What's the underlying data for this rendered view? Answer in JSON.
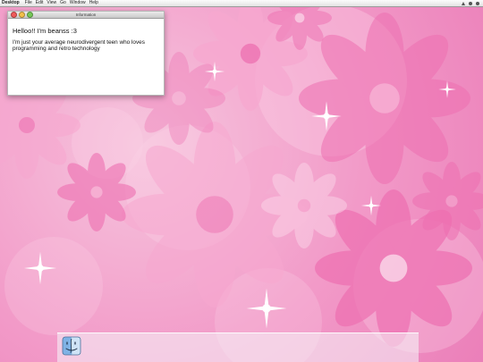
{
  "menubar": {
    "app_name": "Desktop",
    "items": [
      "File",
      "Edit",
      "View",
      "Go",
      "Window",
      "Help"
    ],
    "status_icons": [
      "wifi-icon",
      "volume-icon",
      "user-icon"
    ]
  },
  "window": {
    "title": "Information",
    "greeting": "Helloo!! I'm beanss :3",
    "bio": "I'm just your average neurodivergent teen who loves programming and retro technology"
  },
  "dock": {
    "items": [
      {
        "name": "Finder",
        "icon": "finder-icon"
      }
    ]
  },
  "colors": {
    "wallpaper_base": "#f29ac8",
    "flower_light": "#fbd5e8",
    "flower_mid": "#f7a8d0",
    "flower_deep": "#ee6fb1"
  }
}
